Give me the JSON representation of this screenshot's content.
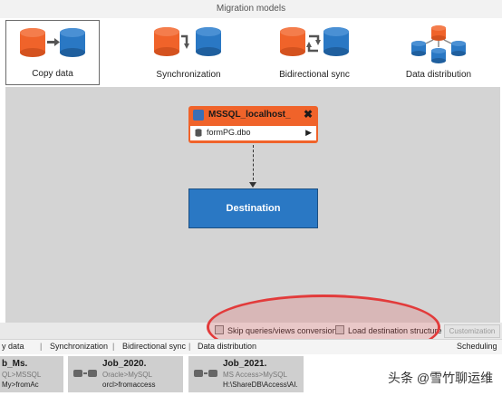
{
  "header": {
    "title": "Migration models"
  },
  "models": [
    {
      "label": "Copy data",
      "selected": true
    },
    {
      "label": "Synchronization",
      "selected": false
    },
    {
      "label": "Bidirectional sync",
      "selected": false
    },
    {
      "label": "Data distribution",
      "selected": false
    }
  ],
  "source": {
    "title": "MSSQL_localhost_",
    "close": "✖",
    "table": "formPG.dbo",
    "expand": "▶"
  },
  "destination": {
    "label": "Destination"
  },
  "options": {
    "skip_queries": "Skip queries/views conversion",
    "load_structure": "Load destination structure",
    "customization": "Customization"
  },
  "tabs": [
    {
      "label": "y data"
    },
    {
      "label": "Synchronization"
    },
    {
      "label": "Bidirectional sync"
    },
    {
      "label": "Data distribution"
    },
    {
      "label": "Scheduling"
    }
  ],
  "jobs": [
    {
      "name": "b_Ms.",
      "line2": "QL>MSSQL",
      "line3": "My>fromAc"
    },
    {
      "name": "Job_2020.",
      "line2": "Oracle>MySQL",
      "line3": "orcl>fromaccess"
    },
    {
      "name": "Job_2021.",
      "line2": "MS Access>MySQL",
      "line3": "H:\\ShareDB\\Access\\AI."
    }
  ],
  "watermark": "头条 @雪竹聊运维",
  "colors": {
    "orange": "#f0632a",
    "blue": "#2a78c4",
    "canvas": "#d4d4d4",
    "highlight": "#e23b3b"
  }
}
